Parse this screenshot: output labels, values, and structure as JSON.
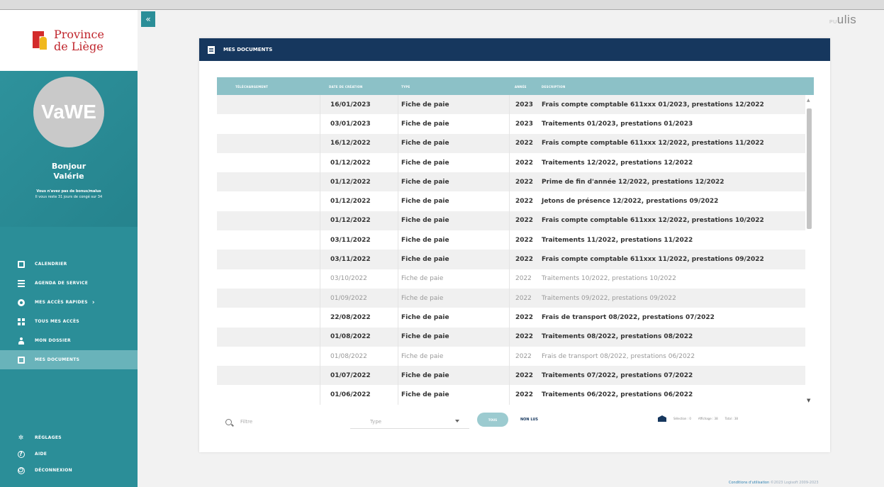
{
  "sidebar": {
    "logo_line1": "Province",
    "logo_line2": "de Liège",
    "avatar_text": "VaWE",
    "greeting": "Bonjour",
    "user_name": "Valérie",
    "note_line1": "Vous n'avez pas de bonus/malus",
    "note_line2": "Il vous reste 31 jours de congé sur 34",
    "menu": [
      {
        "label": "CALENDRIER",
        "icon": "calendar-icon"
      },
      {
        "label": "AGENDA DE SERVICE",
        "icon": "agenda-icon"
      },
      {
        "label": "MES ACCÈS RAPIDES",
        "icon": "quick-access-icon"
      },
      {
        "label": "TOUS MES ACCÈS",
        "icon": "grid-icon"
      },
      {
        "label": "MON DOSSIER",
        "icon": "user-icon"
      },
      {
        "label": "MES DOCUMENTS",
        "icon": "document-icon",
        "active": true
      }
    ],
    "bottom_menu": [
      {
        "label": "RÉGLAGES",
        "icon": "gear-icon"
      },
      {
        "label": "AIDE",
        "icon": "help-icon"
      },
      {
        "label": "DÉCONNEXION",
        "icon": "power-icon"
      }
    ]
  },
  "collapse_glyph": "«",
  "brand": {
    "prefix": "PU",
    "name": "ulis"
  },
  "panel": {
    "title": "MES DOCUMENTS",
    "columns": [
      "TÉLÉCHARGEMENT",
      "DATE DE CRÉATION",
      "TYPE",
      "ANNÉE",
      "DESCRIPTION"
    ],
    "rows": [
      {
        "date": "16/01/2023",
        "type": "Fiche de paie",
        "year": "2023",
        "desc": "Frais compte comptable 611xxx 01/2023, prestations 12/2022",
        "read": false
      },
      {
        "date": "03/01/2023",
        "type": "Fiche de paie",
        "year": "2023",
        "desc": "Traitements 01/2023, prestations 01/2023",
        "read": false
      },
      {
        "date": "16/12/2022",
        "type": "Fiche de paie",
        "year": "2022",
        "desc": "Frais compte comptable 611xxx 12/2022, prestations 11/2022",
        "read": false
      },
      {
        "date": "01/12/2022",
        "type": "Fiche de paie",
        "year": "2022",
        "desc": "Traitements 12/2022, prestations 12/2022",
        "read": false
      },
      {
        "date": "01/12/2022",
        "type": "Fiche de paie",
        "year": "2022",
        "desc": "Prime de fin d'année 12/2022, prestations 12/2022",
        "read": false
      },
      {
        "date": "01/12/2022",
        "type": "Fiche de paie",
        "year": "2022",
        "desc": "Jetons de présence 12/2022, prestations 09/2022",
        "read": false
      },
      {
        "date": "01/12/2022",
        "type": "Fiche de paie",
        "year": "2022",
        "desc": "Frais compte comptable 611xxx 12/2022, prestations 10/2022",
        "read": false
      },
      {
        "date": "03/11/2022",
        "type": "Fiche de paie",
        "year": "2022",
        "desc": "Traitements 11/2022, prestations 11/2022",
        "read": false
      },
      {
        "date": "03/11/2022",
        "type": "Fiche de paie",
        "year": "2022",
        "desc": "Frais compte comptable 611xxx 11/2022, prestations 09/2022",
        "read": false
      },
      {
        "date": "03/10/2022",
        "type": "Fiche de paie",
        "year": "2022",
        "desc": "Traitements 10/2022, prestations 10/2022",
        "read": true
      },
      {
        "date": "01/09/2022",
        "type": "Fiche de paie",
        "year": "2022",
        "desc": "Traitements 09/2022, prestations 09/2022",
        "read": true
      },
      {
        "date": "22/08/2022",
        "type": "Fiche de paie",
        "year": "2022",
        "desc": "Frais de transport 08/2022, prestations 07/2022",
        "read": false
      },
      {
        "date": "01/08/2022",
        "type": "Fiche de paie",
        "year": "2022",
        "desc": "Traitements 08/2022, prestations 08/2022",
        "read": false
      },
      {
        "date": "01/08/2022",
        "type": "Fiche de paie",
        "year": "2022",
        "desc": "Frais de transport 08/2022, prestations 06/2022",
        "read": true
      },
      {
        "date": "01/07/2022",
        "type": "Fiche de paie",
        "year": "2022",
        "desc": "Traitements 07/2022, prestations 07/2022",
        "read": false
      },
      {
        "date": "01/06/2022",
        "type": "Fiche de paie",
        "year": "2022",
        "desc": "Traitements 06/2022, prestations 06/2022",
        "read": false
      }
    ],
    "filter_placeholder": "Filtre",
    "type_placeholder": "Type",
    "btn_all": "TOUS",
    "btn_unread": "NON LUS",
    "selection": "Sélection : 0",
    "display": "Affichage : 38",
    "total": "Total : 38"
  },
  "footer": {
    "link": "Conditions d'utilisation",
    "copyright": "©2023 Logisoft 2009-2023"
  }
}
